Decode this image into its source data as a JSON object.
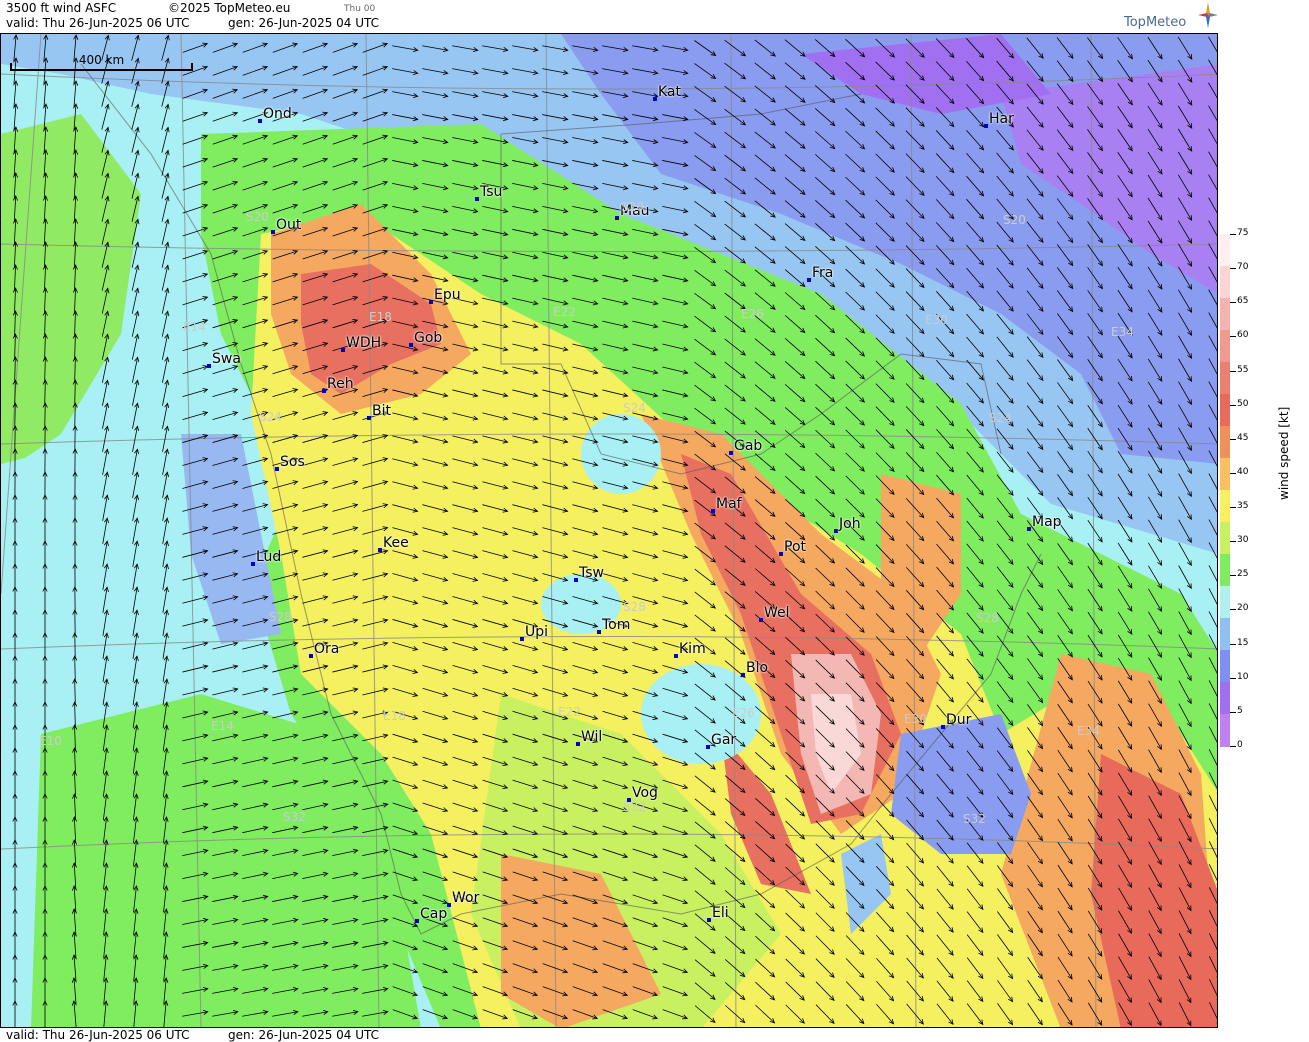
{
  "header": {
    "product": "3500 ft wind ASFC",
    "copyright": "©2025 TopMeteo.eu",
    "day_tag": "Thu 00",
    "valid": "valid:  Thu  26-Jun-2025  06 UTC",
    "gen": "gen: 26-Jun-2025  04 UTC"
  },
  "footer": {
    "valid": "valid:  Thu  26-Jun-2025  06 UTC",
    "gen": "gen: 26-Jun-2025  04 UTC"
  },
  "brand": {
    "logo_text": "TopMeteo"
  },
  "scale_bar": {
    "label": "400 km"
  },
  "legend": {
    "title": "wind speed  [kt]",
    "ticks": [
      "75",
      "70",
      "65",
      "60",
      "55",
      "50",
      "45",
      "40",
      "35",
      "30",
      "25",
      "20",
      "15",
      "10",
      "5",
      "0"
    ],
    "colors": [
      "#ffeef0",
      "#fbd5d5",
      "#f5b3b0",
      "#f09a8f",
      "#ea8070",
      "#e86a5a",
      "#f0905a",
      "#f8c060",
      "#f8f060",
      "#c8f060",
      "#80ec60",
      "#b0f0f0",
      "#90c0f0",
      "#8090f0",
      "#a070f0",
      "#c080f0"
    ]
  },
  "stations": [
    {
      "code": "Ond"
    },
    {
      "code": "Kat"
    },
    {
      "code": "Har"
    },
    {
      "code": "Tsu"
    },
    {
      "code": "Out"
    },
    {
      "code": "Mau"
    },
    {
      "code": "Fra"
    },
    {
      "code": "Epu"
    },
    {
      "code": "Gob"
    },
    {
      "code": "WDH"
    },
    {
      "code": "Swa"
    },
    {
      "code": "Reh"
    },
    {
      "code": "Bit"
    },
    {
      "code": "Gab"
    },
    {
      "code": "Sos"
    },
    {
      "code": "Maf"
    },
    {
      "code": "Joh"
    },
    {
      "code": "Map"
    },
    {
      "code": "Pot"
    },
    {
      "code": "Kee"
    },
    {
      "code": "Lud"
    },
    {
      "code": "Tsw"
    },
    {
      "code": "Wel"
    },
    {
      "code": "Upi"
    },
    {
      "code": "Tom"
    },
    {
      "code": "Kim"
    },
    {
      "code": "Ora"
    },
    {
      "code": "Blo"
    },
    {
      "code": "Dur"
    },
    {
      "code": "Wil"
    },
    {
      "code": "Gar"
    },
    {
      "code": "Vog"
    },
    {
      "code": "Wor"
    },
    {
      "code": "Cap"
    },
    {
      "code": "Eli"
    }
  ],
  "grid_labels": [
    {
      "text": "S20"
    },
    {
      "text": "S20"
    },
    {
      "text": "S20"
    },
    {
      "text": "E14"
    },
    {
      "text": "E18"
    },
    {
      "text": "E22"
    },
    {
      "text": "E26"
    },
    {
      "text": "E30"
    },
    {
      "text": "E34"
    },
    {
      "text": "S24"
    },
    {
      "text": "S24"
    },
    {
      "text": "S24"
    },
    {
      "text": "S28"
    },
    {
      "text": "S28"
    },
    {
      "text": "S28"
    },
    {
      "text": "E10"
    },
    {
      "text": "E14"
    },
    {
      "text": "E18"
    },
    {
      "text": "E22"
    },
    {
      "text": "E26"
    },
    {
      "text": "E30"
    },
    {
      "text": "E34"
    },
    {
      "text": "S32"
    },
    {
      "text": "S32"
    },
    {
      "text": "S32"
    }
  ],
  "colors": {
    "station_marker": "#0000cc",
    "grid_label": "#cccccc",
    "arrow": "#000000"
  }
}
